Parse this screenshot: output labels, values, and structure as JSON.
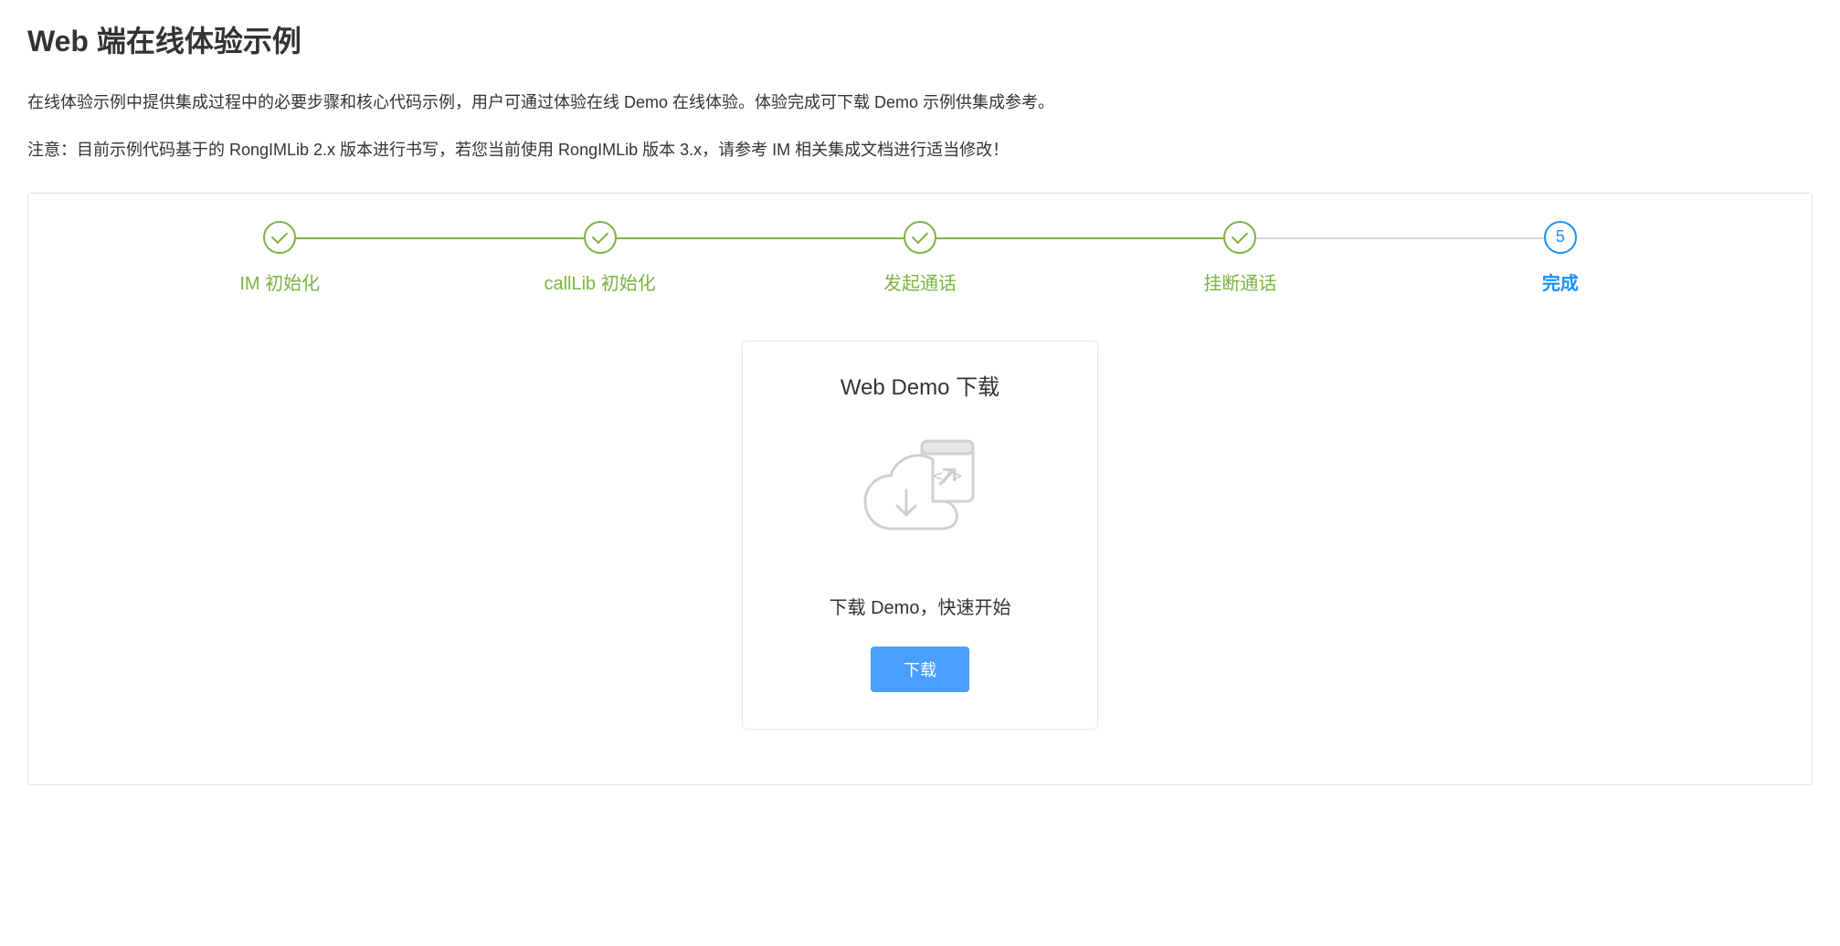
{
  "header": {
    "title": "Web 端在线体验示例",
    "intro": "在线体验示例中提供集成过程中的必要步骤和核心代码示例，用户可通过体验在线 Demo 在线体验。体验完成可下载 Demo 示例供集成参考。",
    "note": "注意：目前示例代码基于的 RongIMLib 2.x 版本进行书写，若您当前使用 RongIMLib 版本 3.x，请参考 IM 相关集成文档进行适当修改！"
  },
  "steps": [
    {
      "label": "IM 初始化",
      "status": "completed"
    },
    {
      "label": "callLib 初始化",
      "status": "completed"
    },
    {
      "label": "发起通话",
      "status": "completed"
    },
    {
      "label": "挂断通话",
      "status": "completed"
    },
    {
      "label": "完成",
      "status": "current",
      "number": "5"
    }
  ],
  "card": {
    "title": "Web Demo 下载",
    "subtitle": "下载 Demo，快速开始",
    "button_label": "下载"
  }
}
